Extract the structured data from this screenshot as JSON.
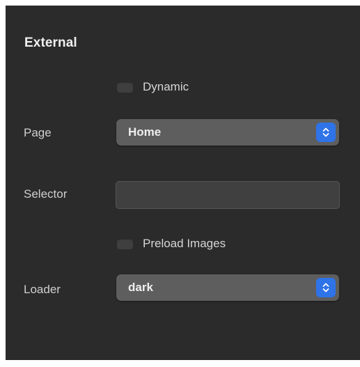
{
  "section": {
    "title": "External"
  },
  "dynamic": {
    "label": "Dynamic",
    "checked": false
  },
  "page": {
    "label": "Page",
    "value": "Home"
  },
  "selector": {
    "label": "Selector",
    "value": ""
  },
  "preload_images": {
    "label": "Preload Images",
    "checked": false
  },
  "loader": {
    "label": "Loader",
    "value": "dark"
  },
  "colors": {
    "panel_background": "#2b2b2b",
    "select_background": "#5e5e5e",
    "stepper_accent": "#2f73e8"
  }
}
